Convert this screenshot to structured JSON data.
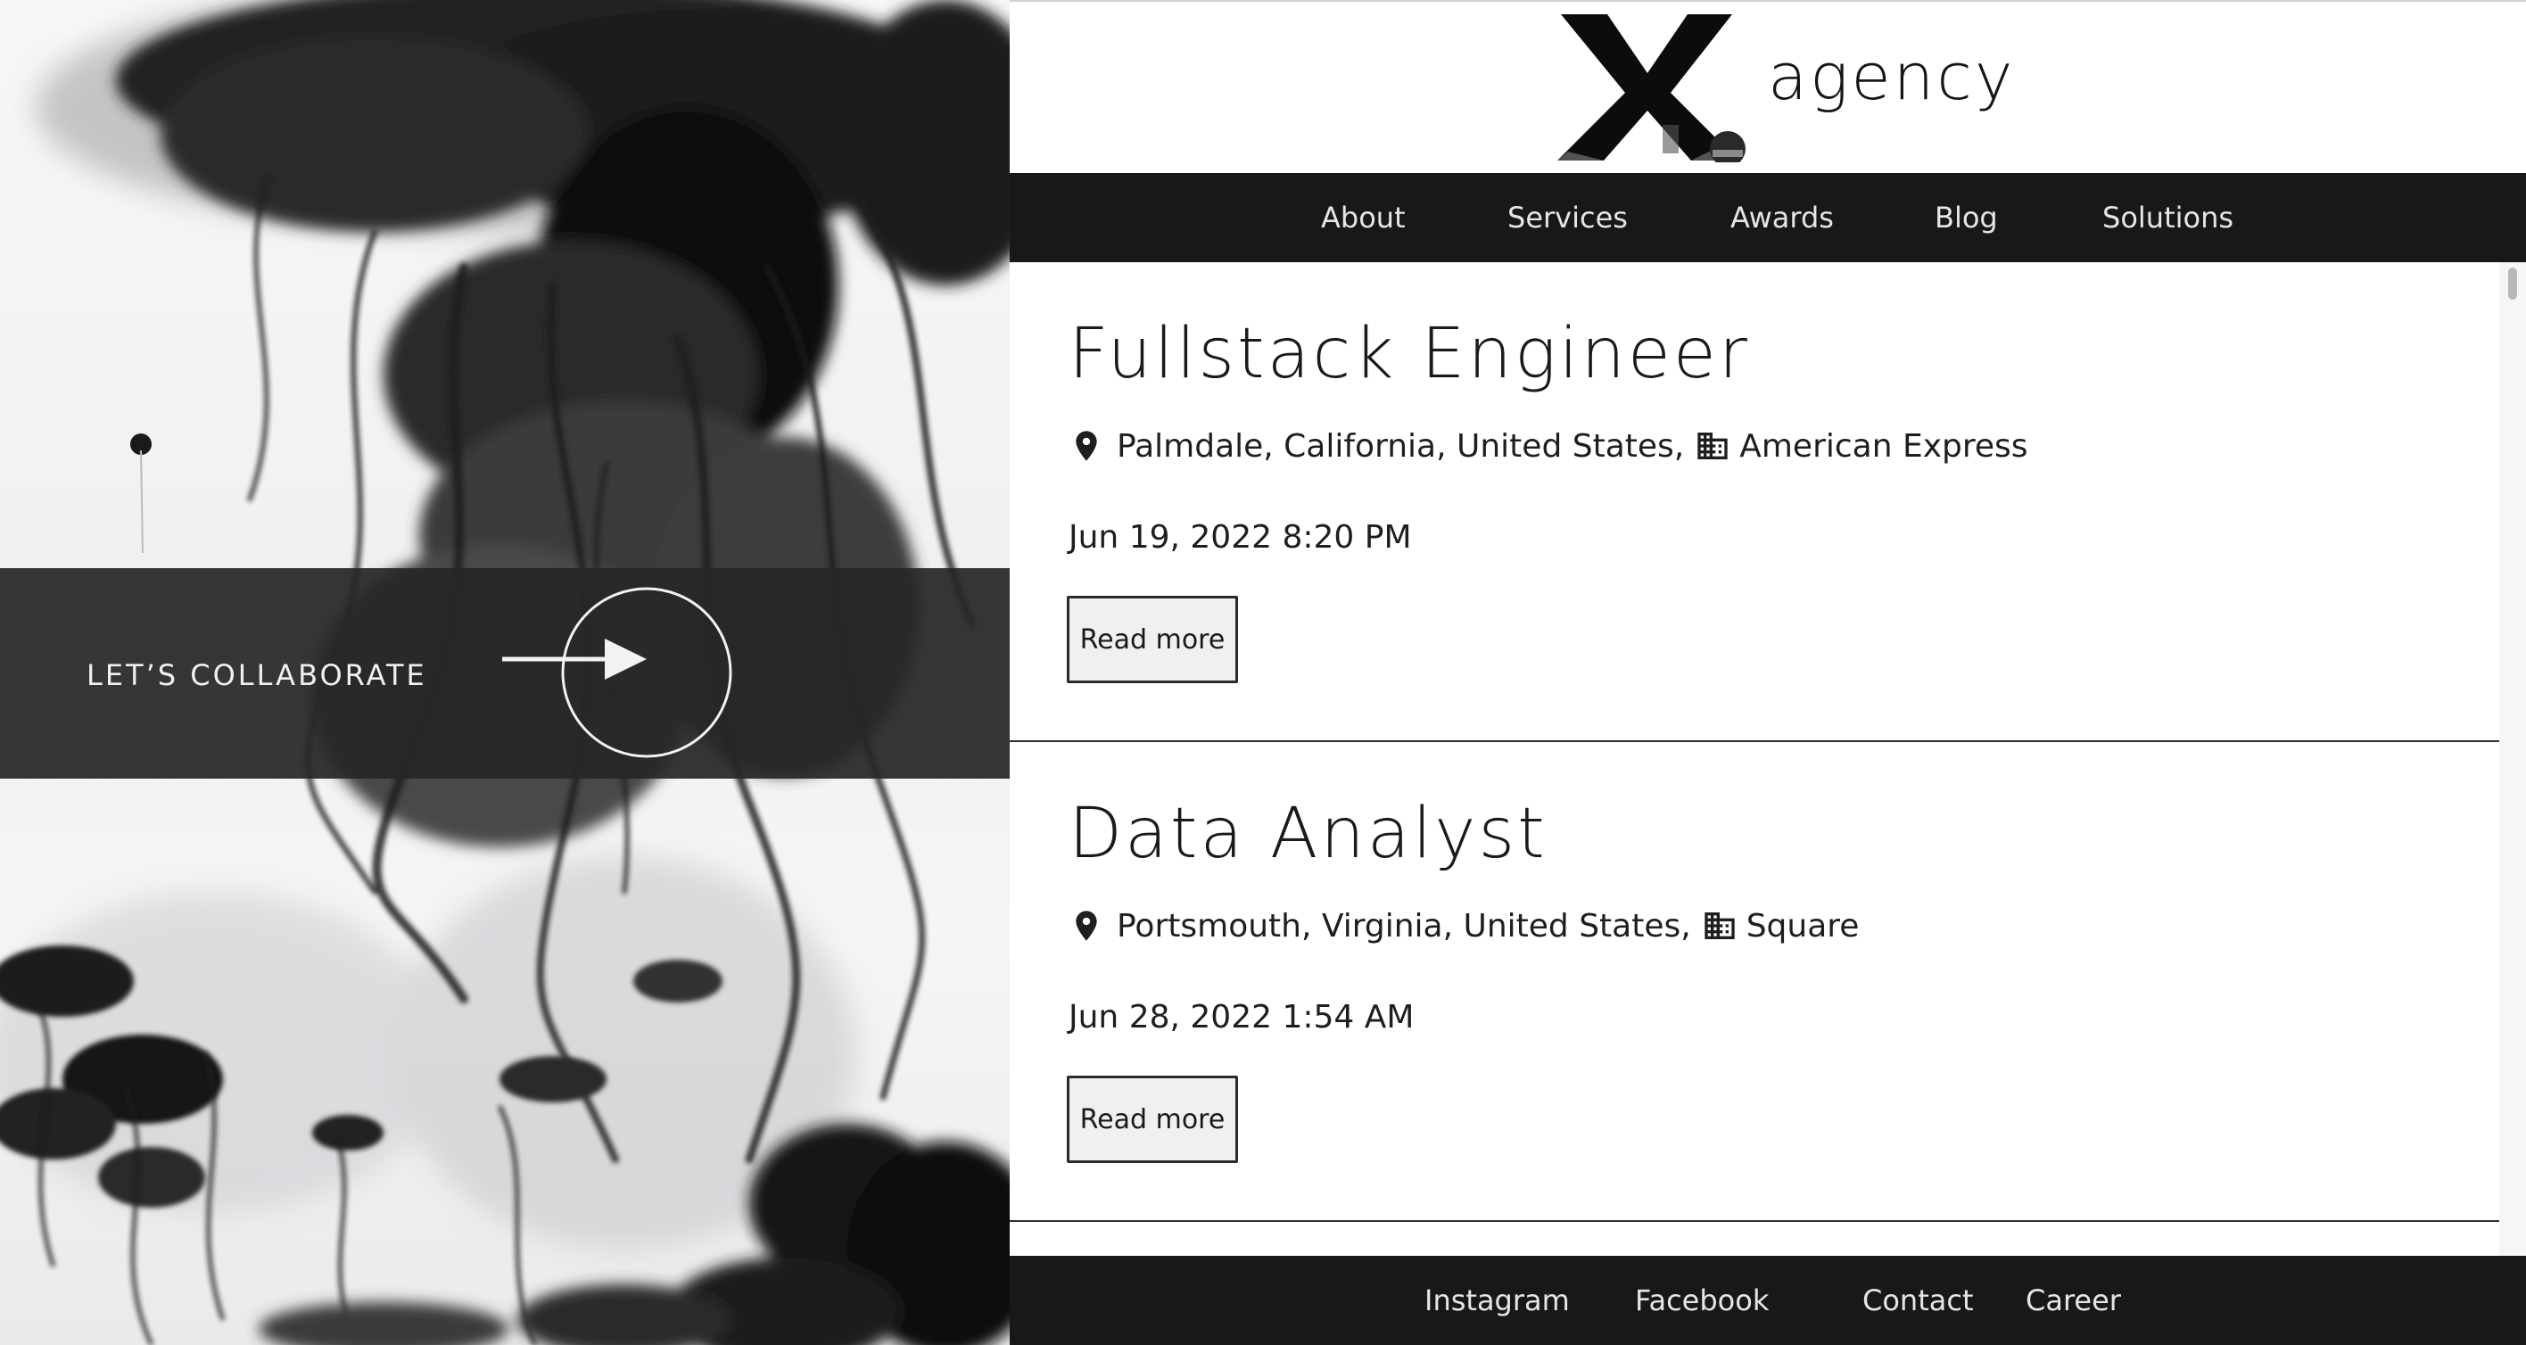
{
  "brand": {
    "logo_letter": "X",
    "name": "agency"
  },
  "hero": {
    "cta_label": "LET’S COLLABORATE",
    "cta_icon": "arrow-right-icon"
  },
  "nav": {
    "items": [
      {
        "label": "About"
      },
      {
        "label": "Services"
      },
      {
        "label": "Awards"
      },
      {
        "label": "Blog"
      },
      {
        "label": "Solutions"
      }
    ]
  },
  "jobs": [
    {
      "title": "Fullstack Engineer",
      "location": "Palmdale, California, United States,",
      "company": "American Express",
      "date": "Jun 19, 2022 8:20 PM",
      "button": "Read more"
    },
    {
      "title": "Data Analyst",
      "location": "Portsmouth, Virginia, United States,",
      "company": "Square",
      "date": "Jun 28, 2022 1:54 AM",
      "button": "Read more"
    }
  ],
  "footer": {
    "items": [
      {
        "label": "Instagram"
      },
      {
        "label": "Facebook"
      },
      {
        "label": "Contact"
      },
      {
        "label": "Career"
      }
    ]
  },
  "colors": {
    "nav_background": "#181818",
    "band_background": "#262828",
    "button_background": "#f0f0f0",
    "text": "#1e1e1e"
  }
}
